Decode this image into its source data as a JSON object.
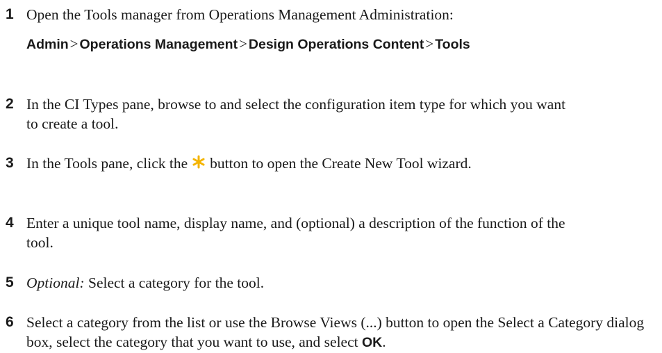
{
  "accent_color": "#f4b400",
  "steps": [
    {
      "number": "1",
      "text": "Open the Tools manager from Operations Management Administration:",
      "path": {
        "items": [
          "Admin",
          "Operations Management",
          "Design Operations Content",
          "Tools"
        ],
        "separator": ">"
      }
    },
    {
      "number": "2",
      "text": "In the CI Types pane, browse to and select the configuration item type for which you want to create a tool."
    },
    {
      "number": "3",
      "before": "In the Tools pane, click the",
      "icon": "new-item-star-icon",
      "after": "button to open the Create New Tool wizard."
    },
    {
      "number": "4",
      "text": "Enter a unique tool name, display name, and (optional) a description of the function of the tool."
    },
    {
      "number": "5",
      "label": "Optional:",
      "text": "Select a category for the tool."
    },
    {
      "number": "6",
      "text": "Select a category from the list or use the Browse Views (...) button to open the Select a Category dialog box, select the category that you want to use, and select",
      "emphasis": "OK",
      "end": "."
    }
  ]
}
